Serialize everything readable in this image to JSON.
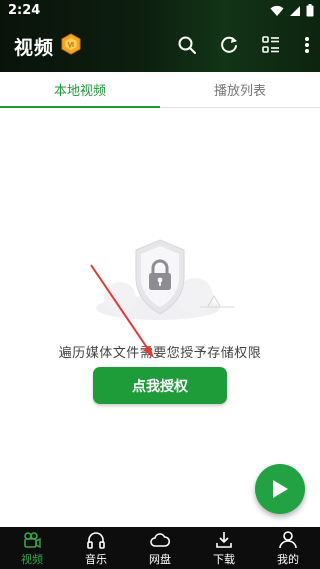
{
  "status_bar": {
    "time": "2:24"
  },
  "app_bar": {
    "title": "视频"
  },
  "tabs": [
    {
      "label": "本地视频",
      "active": true
    },
    {
      "label": "播放列表",
      "active": false
    }
  ],
  "empty_state": {
    "message": "遍历媒体文件需要您授予存储权限",
    "button_label": "点我授权"
  },
  "bottom_nav": [
    {
      "label": "视频",
      "icon": "video-camera-icon",
      "active": true
    },
    {
      "label": "音乐",
      "icon": "headphones-icon",
      "active": false
    },
    {
      "label": "网盘",
      "icon": "cloud-icon",
      "active": false
    },
    {
      "label": "下载",
      "icon": "download-icon",
      "active": false
    },
    {
      "label": "我的",
      "icon": "person-icon",
      "active": false
    }
  ],
  "colors": {
    "accent": "#1f9c3a",
    "header_dark": "#0d1f0f",
    "nav_bg": "#0d0d0d",
    "arrow": "#e53935"
  }
}
